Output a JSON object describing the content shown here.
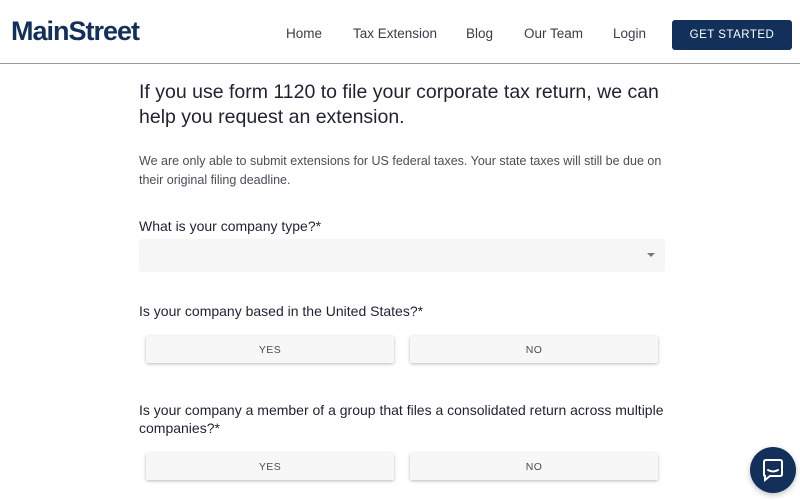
{
  "brand": {
    "name": "MainStreet"
  },
  "nav": {
    "links": [
      "Home",
      "Tax Extension",
      "Blog",
      "Our Team",
      "Login"
    ],
    "cta_label": "GET STARTED"
  },
  "main": {
    "headline": "If you use form 1120 to file your corporate tax return, we can help you request an extension.",
    "intro": "We are only able to submit extensions for US federal taxes. Your state taxes will still be due on their original filing deadline.",
    "questions": [
      {
        "label": "What is your company type?*",
        "type": "select",
        "value": ""
      },
      {
        "label": "Is your company based in the United States?*",
        "type": "yes-no",
        "yes": "YES",
        "no": "NO"
      },
      {
        "label": "Is your company a member of a group that files a consolidated return across multiple companies?*",
        "type": "yes-no",
        "yes": "YES",
        "no": "NO"
      }
    ]
  },
  "colors": {
    "primary": "#12305a",
    "field_bg": "#f6f6f6",
    "text": "#1f2230"
  },
  "icons": {
    "chat": "chat-bubble-icon",
    "select_caret": "caret-down-icon"
  }
}
